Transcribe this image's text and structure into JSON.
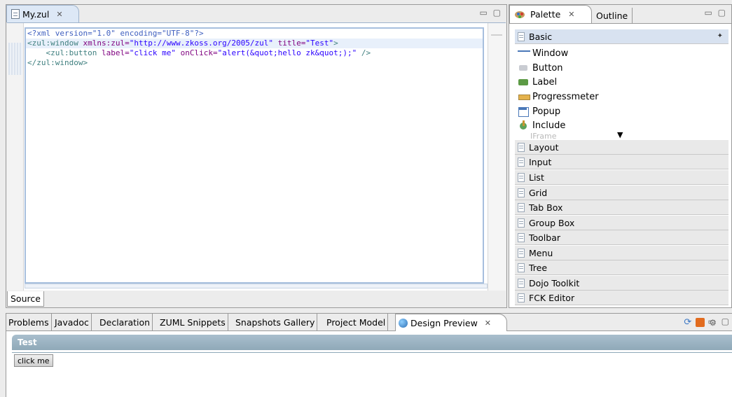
{
  "editor": {
    "tab_label": "My.zul",
    "close_glyph": "✕",
    "win_controls": "▭ ▢",
    "code": {
      "line1": "<?xml version=\"1.0\" encoding=\"UTF-8\"?>",
      "line2_tag_open": "<zul:window ",
      "line2_attr1": "xmlns:zul=",
      "line2_val1": "\"http://www.zkoss.org/2005/zul\"",
      "line2_attr2": " title=",
      "line2_val2": "\"Test\"",
      "line2_end": ">",
      "line3_indent": "    ",
      "line3_tag": "<zul:button ",
      "line3_attr1": "label=",
      "line3_val1": "\"click me\"",
      "line3_attr2": " onClick=",
      "line3_val2": "\"alert(&quot;hello zk&quot;);\"",
      "line3_end": " />",
      "line4": "</zul:window>"
    },
    "source_tab": "Source"
  },
  "palette": {
    "tab_palette": "Palette",
    "tab_outline": "Outline",
    "close_glyph": "✕",
    "win_controls": "▭ ▢",
    "basic_drawer": "Basic",
    "pin_glyph": "✦",
    "items": [
      {
        "label": "Window"
      },
      {
        "label": "Button"
      },
      {
        "label": "Label"
      },
      {
        "label": "Progressmeter"
      },
      {
        "label": "Popup"
      },
      {
        "label": "Include"
      }
    ],
    "partial_item": "IFrame",
    "more_arrow": "▼",
    "drawers": [
      "Layout",
      "Input",
      "List",
      "Grid",
      "Tab Box",
      "Group Box",
      "Toolbar",
      "Menu",
      "Tree",
      "Dojo Toolkit",
      "FCK Editor"
    ]
  },
  "bottom": {
    "tabs": [
      "Problems",
      "Javadoc",
      "Declaration",
      "ZUML Snippets",
      "Snapshots Gallery",
      "Project Model"
    ],
    "active_tab": "Design Preview",
    "close_glyph": "✕",
    "win_controls": "▭ ▢",
    "preview": {
      "window_title": "Test",
      "button_label": "click me"
    }
  }
}
